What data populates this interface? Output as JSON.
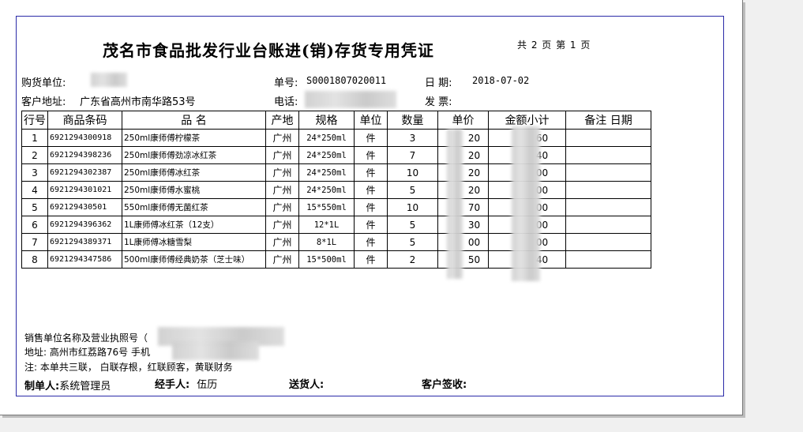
{
  "title": "茂名市食品批发行业台账进(销)存货专用凭证",
  "page_info": "共 2 页 第 1 页",
  "header": {
    "buyer_label": "购货单位:",
    "order_no_label": "单号:",
    "order_no": "S0001807020011",
    "date_label": "日  期:",
    "date": "2018-07-02",
    "address_label": "客户地址:",
    "address": "广东省高州市南华路53号",
    "phone_label": "电话:",
    "invoice_label": "发  票:"
  },
  "table": {
    "columns": [
      "行号",
      "商品条码",
      "品    名",
      "产地",
      "规格",
      "单位",
      "数量",
      "单价",
      "金额小计",
      "备注   日期"
    ],
    "rows": [
      {
        "no": "1",
        "code": "6921294300918",
        "name": "250ml康师傅柠檬茶",
        "origin": "广州",
        "spec": "24*250ml",
        "unit": "件",
        "qty": "3",
        "price": "20",
        "amount": "60"
      },
      {
        "no": "2",
        "code": "6921294398236",
        "name": "250ml康师傅劲凉冰红茶",
        "origin": "广州",
        "spec": "24*250ml",
        "unit": "件",
        "qty": "7",
        "price": "20",
        "amount": "40"
      },
      {
        "no": "3",
        "code": "6921294302387",
        "name": "250ml康师傅冰红茶",
        "origin": "广州",
        "spec": "24*250ml",
        "unit": "件",
        "qty": "10",
        "price": "20",
        "amount": "00"
      },
      {
        "no": "4",
        "code": "6921294301021",
        "name": "250ml康师傅水蜜桃",
        "origin": "广州",
        "spec": "24*250ml",
        "unit": "件",
        "qty": "5",
        "price": "20",
        "amount": "00"
      },
      {
        "no": "5",
        "code": "692129430501",
        "name": "550ml康师傅无菌红茶",
        "origin": "广州",
        "spec": "15*550ml",
        "unit": "件",
        "qty": "10",
        "price": "70",
        "amount": "00"
      },
      {
        "no": "6",
        "code": "6921294396362",
        "name": "1L康师傅冰红茶（12支）",
        "origin": "广州",
        "spec": "12*1L",
        "unit": "件",
        "qty": "5",
        "price": "30",
        "amount": "00"
      },
      {
        "no": "7",
        "code": "6921294389371",
        "name": "1L康师傅冰糖雪梨",
        "origin": "广州",
        "spec": "8*1L",
        "unit": "件",
        "qty": "5",
        "price": "00",
        "amount": "00"
      },
      {
        "no": "8",
        "code": "6921294347586",
        "name": "500ml康师傅经典奶茶（芝士味）",
        "origin": "广州",
        "spec": "15*500ml",
        "unit": "件",
        "qty": "2",
        "price": "50",
        "amount": "40"
      }
    ]
  },
  "footer": {
    "seller_label": "销售单位名称及营业执照号（",
    "address_line": "地址: 高州市红荔路76号   手机",
    "note": "注: 本单共三联，  白联存根，红联顾客，黄联财务",
    "maker_label": "制单人:",
    "maker": "系统管理员",
    "handler_label": "经手人:",
    "handler": "伍历",
    "deliverer_label": "送货人:",
    "customer_sign_label": "客户签收:"
  }
}
